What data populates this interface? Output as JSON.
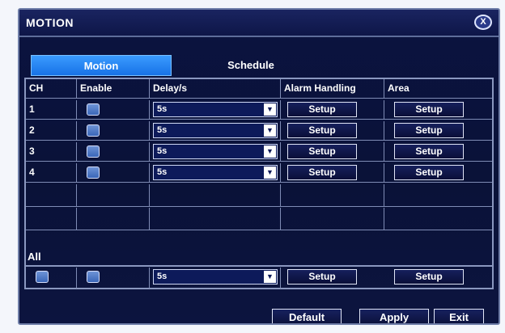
{
  "window": {
    "title": "MOTION",
    "close_label": "X"
  },
  "tabs": [
    {
      "label": "Motion",
      "active": true
    },
    {
      "label": "Schedule",
      "active": false
    }
  ],
  "table": {
    "headers": [
      "CH",
      "Enable",
      "Delay/s",
      "Alarm  Handling",
      "Area"
    ],
    "rows": [
      {
        "ch": "1",
        "delay": "5s",
        "alarm_button": "Setup",
        "area_button": "Setup"
      },
      {
        "ch": "2",
        "delay": "5s",
        "alarm_button": "Setup",
        "area_button": "Setup"
      },
      {
        "ch": "3",
        "delay": "5s",
        "alarm_button": "Setup",
        "area_button": "Setup"
      },
      {
        "ch": "4",
        "delay": "5s",
        "alarm_button": "Setup",
        "area_button": "Setup"
      }
    ]
  },
  "all": {
    "label": "All",
    "delay": "5s",
    "alarm_button": "Setup",
    "area_button": "Setup"
  },
  "buttons": {
    "default": "Default",
    "apply": "Apply",
    "exit": "Exit"
  },
  "icons": {
    "dropdown": "chevron-down-icon",
    "close": "close-icon"
  },
  "colors": {
    "tab_active": "#1872e6",
    "background": "#0a1238",
    "border": "#8a97bf"
  }
}
